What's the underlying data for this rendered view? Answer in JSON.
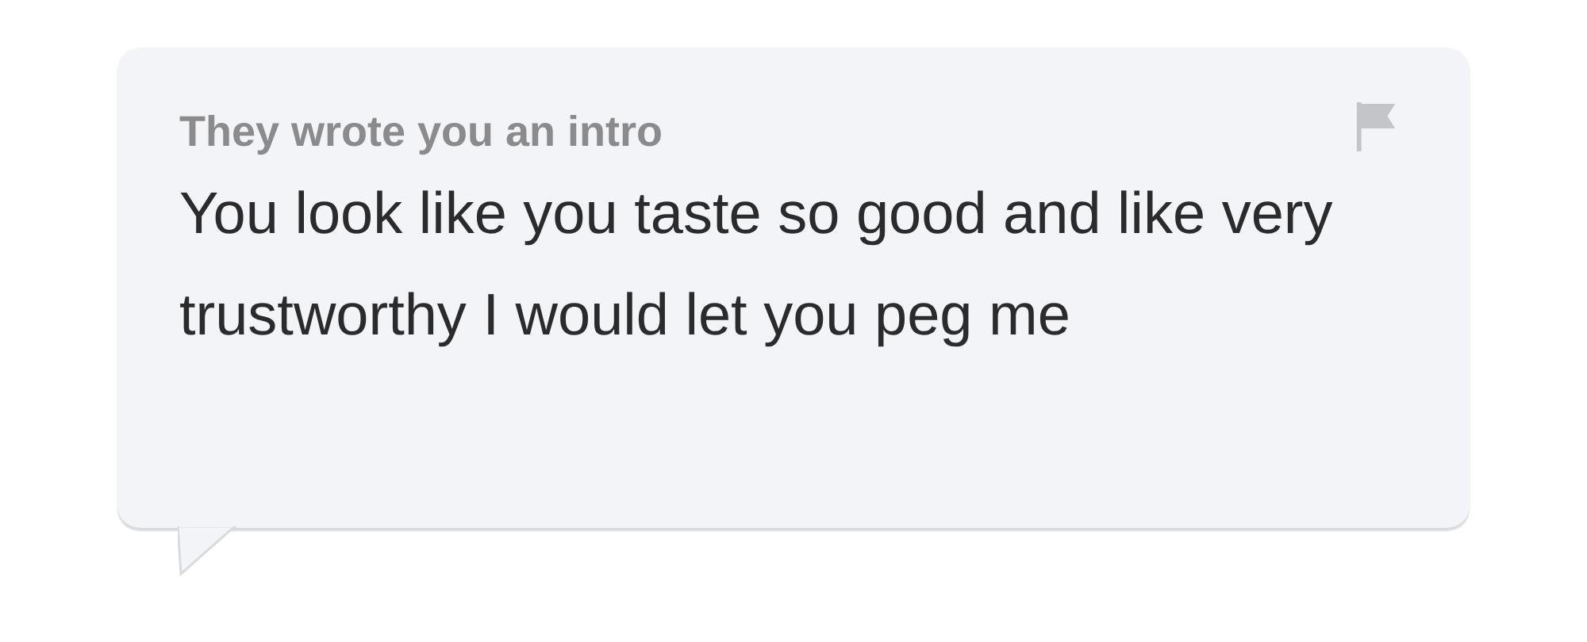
{
  "intro": {
    "label": "They wrote you an intro",
    "message": "You look like you taste so good and like very trustworthy I would let you peg me"
  }
}
